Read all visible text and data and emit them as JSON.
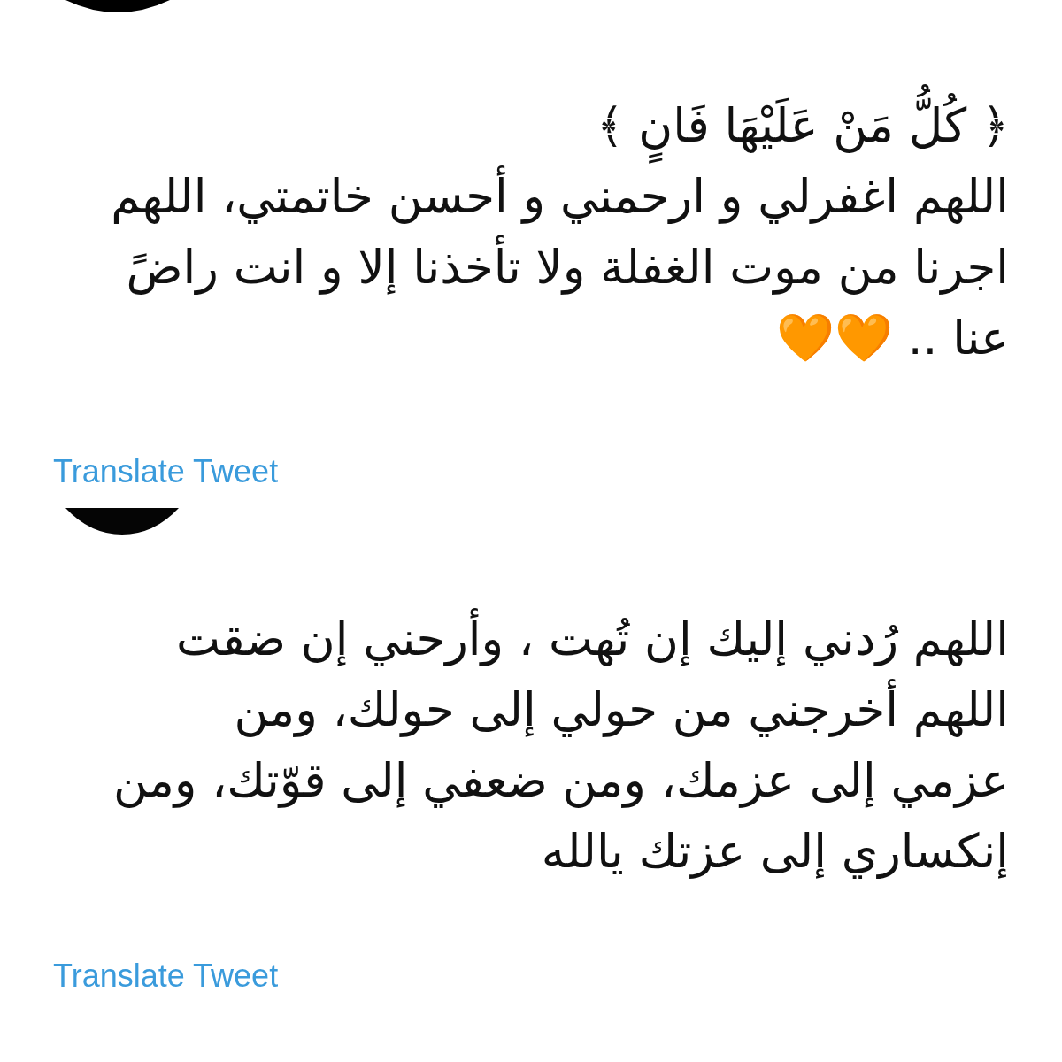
{
  "tweets": [
    {
      "avatar": {
        "kind": "cut"
      },
      "lines": [
        "﴿ كُلُّ مَنْ عَلَيْهَا فَانٍ ﴾",
        "اللهم اغفرلي و ارحمني و أحسن خاتمتي، اللهم",
        "اجرنا من موت الغفلة ولا تأخذنا إلا و انت راضً",
        "عنا .. 🧡🧡"
      ],
      "translate": "Translate Tweet"
    },
    {
      "avatar": {
        "kind": "cut"
      },
      "lines": [
        "اللهم رُدني إليك إن تُهت ، وأرحني إن ضقت",
        "اللهم أخرجني من حولي إلى حولك، ومن",
        "عزمي إلى عزمك، ومن ضعفي إلى قوّتك، ومن",
        "إنكساري إلى عزتك يالله"
      ],
      "translate": "Translate Tweet"
    }
  ]
}
